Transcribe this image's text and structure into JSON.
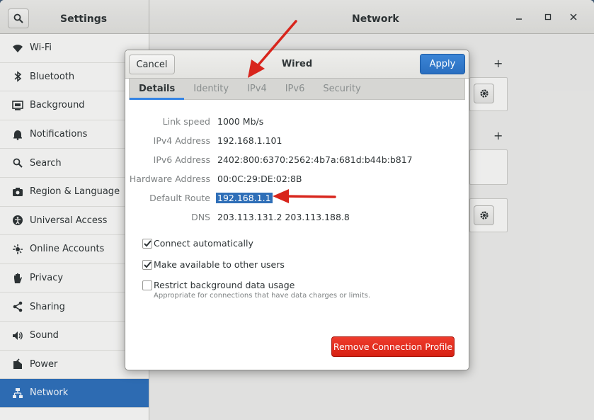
{
  "header": {
    "left_title": "Settings",
    "right_title": "Network"
  },
  "sidebar": {
    "items": [
      {
        "label": "Wi-Fi",
        "icon": "wifi-icon"
      },
      {
        "label": "Bluetooth",
        "icon": "bluetooth-icon"
      },
      {
        "label": "Background",
        "icon": "background-icon"
      },
      {
        "label": "Notifications",
        "icon": "bell-icon"
      },
      {
        "label": "Search",
        "icon": "search-icon"
      },
      {
        "label": "Region & Language",
        "icon": "camera-icon"
      },
      {
        "label": "Universal Access",
        "icon": "accessibility-icon"
      },
      {
        "label": "Online Accounts",
        "icon": "accounts-icon"
      },
      {
        "label": "Privacy",
        "icon": "hand-icon"
      },
      {
        "label": "Sharing",
        "icon": "share-icon"
      },
      {
        "label": "Sound",
        "icon": "speaker-icon"
      },
      {
        "label": "Power",
        "icon": "power-icon"
      },
      {
        "label": "Network",
        "icon": "network-icon",
        "selected": true
      }
    ]
  },
  "dialog": {
    "title": "Wired",
    "cancel_label": "Cancel",
    "apply_label": "Apply",
    "tabs": [
      {
        "label": "Details",
        "active": true
      },
      {
        "label": "Identity"
      },
      {
        "label": "IPv4"
      },
      {
        "label": "IPv6"
      },
      {
        "label": "Security"
      }
    ],
    "details": [
      {
        "label": "Link speed",
        "value": "1000 Mb/s"
      },
      {
        "label": "IPv4 Address",
        "value": "192.168.1.101"
      },
      {
        "label": "IPv6 Address",
        "value": "2402:800:6370:2562:4b7a:681d:b44b:b817"
      },
      {
        "label": "Hardware Address",
        "value": "00:0C:29:DE:02:8B"
      },
      {
        "label": "Default Route",
        "value": "192.168.1.1",
        "selected": true
      },
      {
        "label": "DNS",
        "value": "203.113.131.2 203.113.188.8"
      }
    ],
    "options": [
      {
        "label": "Connect automatically",
        "checked": true
      },
      {
        "label": "Make available to other users",
        "checked": true
      },
      {
        "label": "Restrict background data usage",
        "checked": false,
        "sublabel": "Appropriate for connections that have data charges or limits."
      }
    ],
    "remove_label": "Remove Connection Profile"
  },
  "colors": {
    "accent": "#2f6fb8",
    "apply": "#3584e4",
    "destructive": "#e0281a",
    "annotation_arrow": "#d8251c"
  }
}
